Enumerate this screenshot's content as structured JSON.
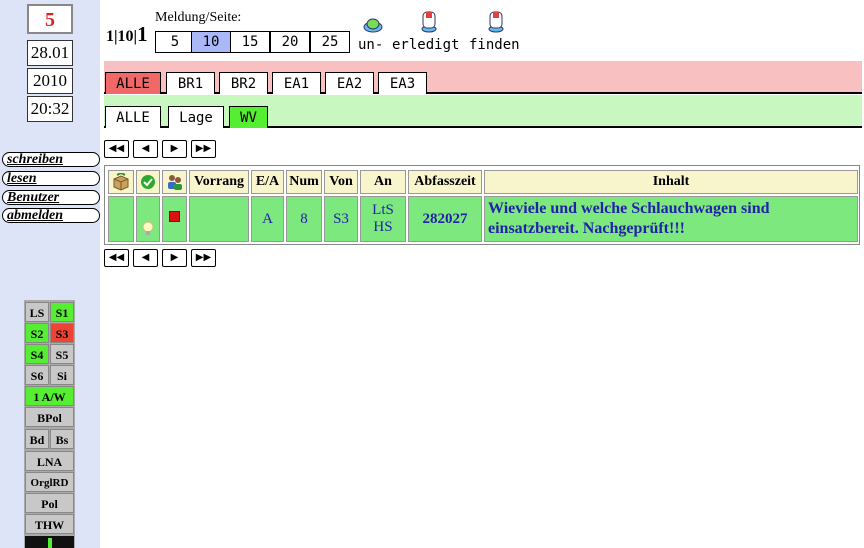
{
  "sidebar": {
    "number": "5",
    "date": "28.01",
    "year": "2010",
    "time": "20:32",
    "buttons": [
      "schreiben",
      "lesen",
      "Benutzer",
      "abmelden"
    ],
    "stations": {
      "ls": "LS",
      "s1": "S1",
      "s2": "S2",
      "s3": "S3",
      "s4": "S4",
      "s5": "S5",
      "s6": "S6",
      "si": "Si",
      "aw": "1 A/W",
      "bpol": "BPol",
      "bd": "Bd",
      "bs": "Bs",
      "lna": "LNA",
      "orglrd": "OrglRD",
      "pol": "Pol",
      "thw": "THW"
    },
    "colors": {
      "green": "#55ee33",
      "red": "#ee4433",
      "gray": "#c8c8c8"
    }
  },
  "header": {
    "counter_a": "1",
    "counter_b": "10",
    "counter_c": "1",
    "per_page_label": "Meldung/Seite:",
    "per_page_options": [
      "5",
      "10",
      "15",
      "20",
      "25"
    ],
    "per_page_selected": "10",
    "icon_labels": [
      "un-",
      "erledigt",
      "finden"
    ]
  },
  "tabs1": [
    "ALLE",
    "BR1",
    "BR2",
    "EA1",
    "EA2",
    "EA3"
  ],
  "tabs2": [
    "ALLE",
    "Lage",
    "WV"
  ],
  "table": {
    "headers": [
      "Vorrang",
      "E/A",
      "Num",
      "Von",
      "An",
      "Abfasszeit",
      "Inhalt"
    ],
    "row": {
      "ea": "A",
      "num": "8",
      "von": "S3",
      "an_1": "LtS",
      "an_2": "HS",
      "abfasszeit": "282027",
      "inhalt": "Wieviele und welche Schlauchwagen sind einsatzbereit. Nachgeprüft!!!"
    }
  },
  "accent": {
    "tab_active_red": "#f06868",
    "tab_active_green": "#55ee33",
    "row_green": "#7de87d",
    "header_yellow": "#f8f4cc"
  }
}
